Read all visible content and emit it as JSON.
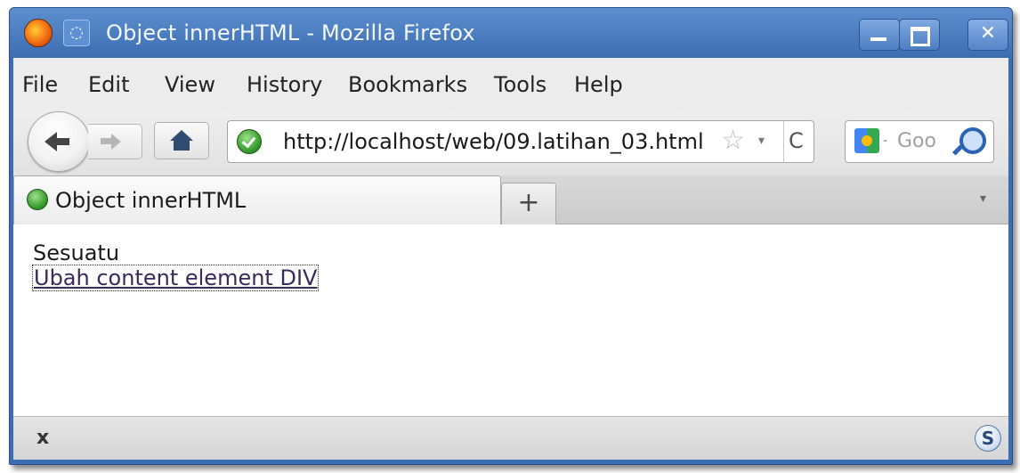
{
  "window": {
    "title": "Object innerHTML - Mozilla Firefox",
    "buttons": {
      "minimize": "minimize",
      "maximize": "maximize",
      "close": "✕"
    }
  },
  "menubar": {
    "items": [
      "File",
      "Edit",
      "View",
      "History",
      "Bookmarks",
      "Tools",
      "Help"
    ]
  },
  "navbar": {
    "url": "http://localhost/web/09.latihan_03.html",
    "search_placeholder": "Goo",
    "reload_glyph": "C",
    "star_glyph": "☆",
    "dropdown_glyph": "▾",
    "search_drop_glyph": "-"
  },
  "tabs": [
    {
      "label": "Object innerHTML",
      "active": true
    }
  ],
  "newtab_label": "+",
  "tablist_glyph": "▾",
  "content": {
    "text": "Sesuatu",
    "link": "Ubah content element DIV"
  },
  "statusbar": {
    "close_glyph": "x",
    "addon_glyph": "S"
  },
  "icons": {
    "app": "firefox-icon",
    "menu": "window-menu-icon",
    "back": "back-arrow-icon",
    "forward": "forward-arrow-icon",
    "home": "home-icon",
    "site_identity": "shield-icon",
    "bookmark": "star-icon",
    "reload": "reload-icon",
    "search_engine": "google-icon",
    "search": "magnifier-icon"
  },
  "colors": {
    "titlebar": "#3d6db1",
    "link": "#3a2a5c"
  }
}
